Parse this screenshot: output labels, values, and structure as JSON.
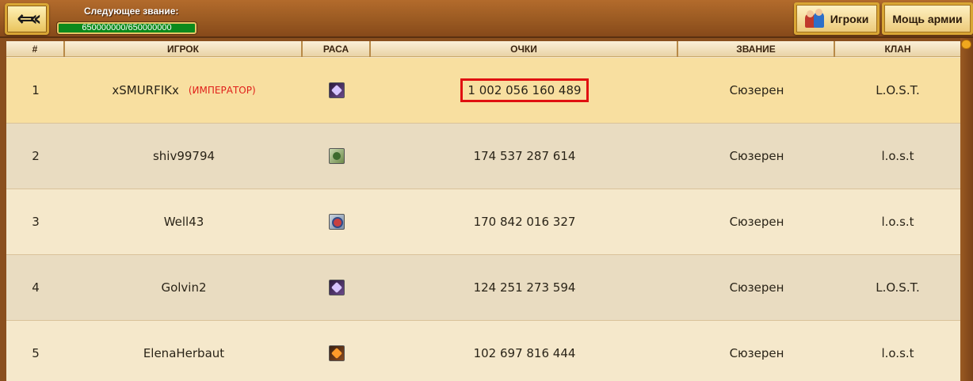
{
  "header": {
    "back_icon": "back-arrow-icon",
    "rank_label": "Следующее звание:",
    "rank_progress_text": "650000000/650000000",
    "rank_progress_fraction": 1.0,
    "players_button": "Игроки",
    "players_icon": "players-icon",
    "army_button": "Мощь армии"
  },
  "table": {
    "columns": [
      "#",
      "ИГРОК",
      "РАСА",
      "ОЧКИ",
      "ЗВАНИЕ",
      "КЛАН"
    ],
    "rows": [
      {
        "num": "1",
        "player": "xSMURFIKx",
        "title": "(ИМПЕРАТОР)",
        "race_icon": "race-purple",
        "score": "1 002 056 160 489",
        "rank": "Сюзерен",
        "clan": "L.O.S.T."
      },
      {
        "num": "2",
        "player": "shiv99794",
        "title": "",
        "race_icon": "race-green",
        "score": "174 537 287 614",
        "rank": "Сюзерен",
        "clan": "l.o.s.t"
      },
      {
        "num": "3",
        "player": "Well43",
        "title": "",
        "race_icon": "race-blue",
        "score": "170 842 016 327",
        "rank": "Сюзерен",
        "clan": "l.o.s.t"
      },
      {
        "num": "4",
        "player": "Golvin2",
        "title": "",
        "race_icon": "race-purple",
        "score": "124 251 273 594",
        "rank": "Сюзерен",
        "clan": "L.O.S.T."
      },
      {
        "num": "5",
        "player": "ElenaHerbaut",
        "title": "",
        "race_icon": "race-orange",
        "score": "102 697 816 444",
        "rank": "Сюзерен",
        "clan": "l.o.s.t"
      }
    ]
  },
  "colors": {
    "highlight_row": "#f8dfa0",
    "score_outline": "#e01010",
    "title_text": "#e0201a",
    "progress_bar": "#0b8a1c"
  }
}
